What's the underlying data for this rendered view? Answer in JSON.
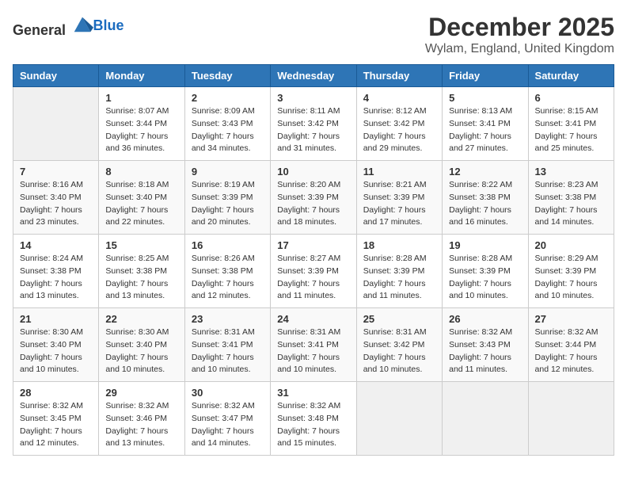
{
  "header": {
    "logo_general": "General",
    "logo_blue": "Blue",
    "month": "December 2025",
    "location": "Wylam, England, United Kingdom"
  },
  "days_of_week": [
    "Sunday",
    "Monday",
    "Tuesday",
    "Wednesday",
    "Thursday",
    "Friday",
    "Saturday"
  ],
  "weeks": [
    [
      {
        "day": "",
        "sunrise": "",
        "sunset": "",
        "daylight": ""
      },
      {
        "day": "1",
        "sunrise": "Sunrise: 8:07 AM",
        "sunset": "Sunset: 3:44 PM",
        "daylight": "Daylight: 7 hours and 36 minutes."
      },
      {
        "day": "2",
        "sunrise": "Sunrise: 8:09 AM",
        "sunset": "Sunset: 3:43 PM",
        "daylight": "Daylight: 7 hours and 34 minutes."
      },
      {
        "day": "3",
        "sunrise": "Sunrise: 8:11 AM",
        "sunset": "Sunset: 3:42 PM",
        "daylight": "Daylight: 7 hours and 31 minutes."
      },
      {
        "day": "4",
        "sunrise": "Sunrise: 8:12 AM",
        "sunset": "Sunset: 3:42 PM",
        "daylight": "Daylight: 7 hours and 29 minutes."
      },
      {
        "day": "5",
        "sunrise": "Sunrise: 8:13 AM",
        "sunset": "Sunset: 3:41 PM",
        "daylight": "Daylight: 7 hours and 27 minutes."
      },
      {
        "day": "6",
        "sunrise": "Sunrise: 8:15 AM",
        "sunset": "Sunset: 3:41 PM",
        "daylight": "Daylight: 7 hours and 25 minutes."
      }
    ],
    [
      {
        "day": "7",
        "sunrise": "Sunrise: 8:16 AM",
        "sunset": "Sunset: 3:40 PM",
        "daylight": "Daylight: 7 hours and 23 minutes."
      },
      {
        "day": "8",
        "sunrise": "Sunrise: 8:18 AM",
        "sunset": "Sunset: 3:40 PM",
        "daylight": "Daylight: 7 hours and 22 minutes."
      },
      {
        "day": "9",
        "sunrise": "Sunrise: 8:19 AM",
        "sunset": "Sunset: 3:39 PM",
        "daylight": "Daylight: 7 hours and 20 minutes."
      },
      {
        "day": "10",
        "sunrise": "Sunrise: 8:20 AM",
        "sunset": "Sunset: 3:39 PM",
        "daylight": "Daylight: 7 hours and 18 minutes."
      },
      {
        "day": "11",
        "sunrise": "Sunrise: 8:21 AM",
        "sunset": "Sunset: 3:39 PM",
        "daylight": "Daylight: 7 hours and 17 minutes."
      },
      {
        "day": "12",
        "sunrise": "Sunrise: 8:22 AM",
        "sunset": "Sunset: 3:38 PM",
        "daylight": "Daylight: 7 hours and 16 minutes."
      },
      {
        "day": "13",
        "sunrise": "Sunrise: 8:23 AM",
        "sunset": "Sunset: 3:38 PM",
        "daylight": "Daylight: 7 hours and 14 minutes."
      }
    ],
    [
      {
        "day": "14",
        "sunrise": "Sunrise: 8:24 AM",
        "sunset": "Sunset: 3:38 PM",
        "daylight": "Daylight: 7 hours and 13 minutes."
      },
      {
        "day": "15",
        "sunrise": "Sunrise: 8:25 AM",
        "sunset": "Sunset: 3:38 PM",
        "daylight": "Daylight: 7 hours and 13 minutes."
      },
      {
        "day": "16",
        "sunrise": "Sunrise: 8:26 AM",
        "sunset": "Sunset: 3:38 PM",
        "daylight": "Daylight: 7 hours and 12 minutes."
      },
      {
        "day": "17",
        "sunrise": "Sunrise: 8:27 AM",
        "sunset": "Sunset: 3:39 PM",
        "daylight": "Daylight: 7 hours and 11 minutes."
      },
      {
        "day": "18",
        "sunrise": "Sunrise: 8:28 AM",
        "sunset": "Sunset: 3:39 PM",
        "daylight": "Daylight: 7 hours and 11 minutes."
      },
      {
        "day": "19",
        "sunrise": "Sunrise: 8:28 AM",
        "sunset": "Sunset: 3:39 PM",
        "daylight": "Daylight: 7 hours and 10 minutes."
      },
      {
        "day": "20",
        "sunrise": "Sunrise: 8:29 AM",
        "sunset": "Sunset: 3:39 PM",
        "daylight": "Daylight: 7 hours and 10 minutes."
      }
    ],
    [
      {
        "day": "21",
        "sunrise": "Sunrise: 8:30 AM",
        "sunset": "Sunset: 3:40 PM",
        "daylight": "Daylight: 7 hours and 10 minutes."
      },
      {
        "day": "22",
        "sunrise": "Sunrise: 8:30 AM",
        "sunset": "Sunset: 3:40 PM",
        "daylight": "Daylight: 7 hours and 10 minutes."
      },
      {
        "day": "23",
        "sunrise": "Sunrise: 8:31 AM",
        "sunset": "Sunset: 3:41 PM",
        "daylight": "Daylight: 7 hours and 10 minutes."
      },
      {
        "day": "24",
        "sunrise": "Sunrise: 8:31 AM",
        "sunset": "Sunset: 3:41 PM",
        "daylight": "Daylight: 7 hours and 10 minutes."
      },
      {
        "day": "25",
        "sunrise": "Sunrise: 8:31 AM",
        "sunset": "Sunset: 3:42 PM",
        "daylight": "Daylight: 7 hours and 10 minutes."
      },
      {
        "day": "26",
        "sunrise": "Sunrise: 8:32 AM",
        "sunset": "Sunset: 3:43 PM",
        "daylight": "Daylight: 7 hours and 11 minutes."
      },
      {
        "day": "27",
        "sunrise": "Sunrise: 8:32 AM",
        "sunset": "Sunset: 3:44 PM",
        "daylight": "Daylight: 7 hours and 12 minutes."
      }
    ],
    [
      {
        "day": "28",
        "sunrise": "Sunrise: 8:32 AM",
        "sunset": "Sunset: 3:45 PM",
        "daylight": "Daylight: 7 hours and 12 minutes."
      },
      {
        "day": "29",
        "sunrise": "Sunrise: 8:32 AM",
        "sunset": "Sunset: 3:46 PM",
        "daylight": "Daylight: 7 hours and 13 minutes."
      },
      {
        "day": "30",
        "sunrise": "Sunrise: 8:32 AM",
        "sunset": "Sunset: 3:47 PM",
        "daylight": "Daylight: 7 hours and 14 minutes."
      },
      {
        "day": "31",
        "sunrise": "Sunrise: 8:32 AM",
        "sunset": "Sunset: 3:48 PM",
        "daylight": "Daylight: 7 hours and 15 minutes."
      },
      {
        "day": "",
        "sunrise": "",
        "sunset": "",
        "daylight": ""
      },
      {
        "day": "",
        "sunrise": "",
        "sunset": "",
        "daylight": ""
      },
      {
        "day": "",
        "sunrise": "",
        "sunset": "",
        "daylight": ""
      }
    ]
  ]
}
